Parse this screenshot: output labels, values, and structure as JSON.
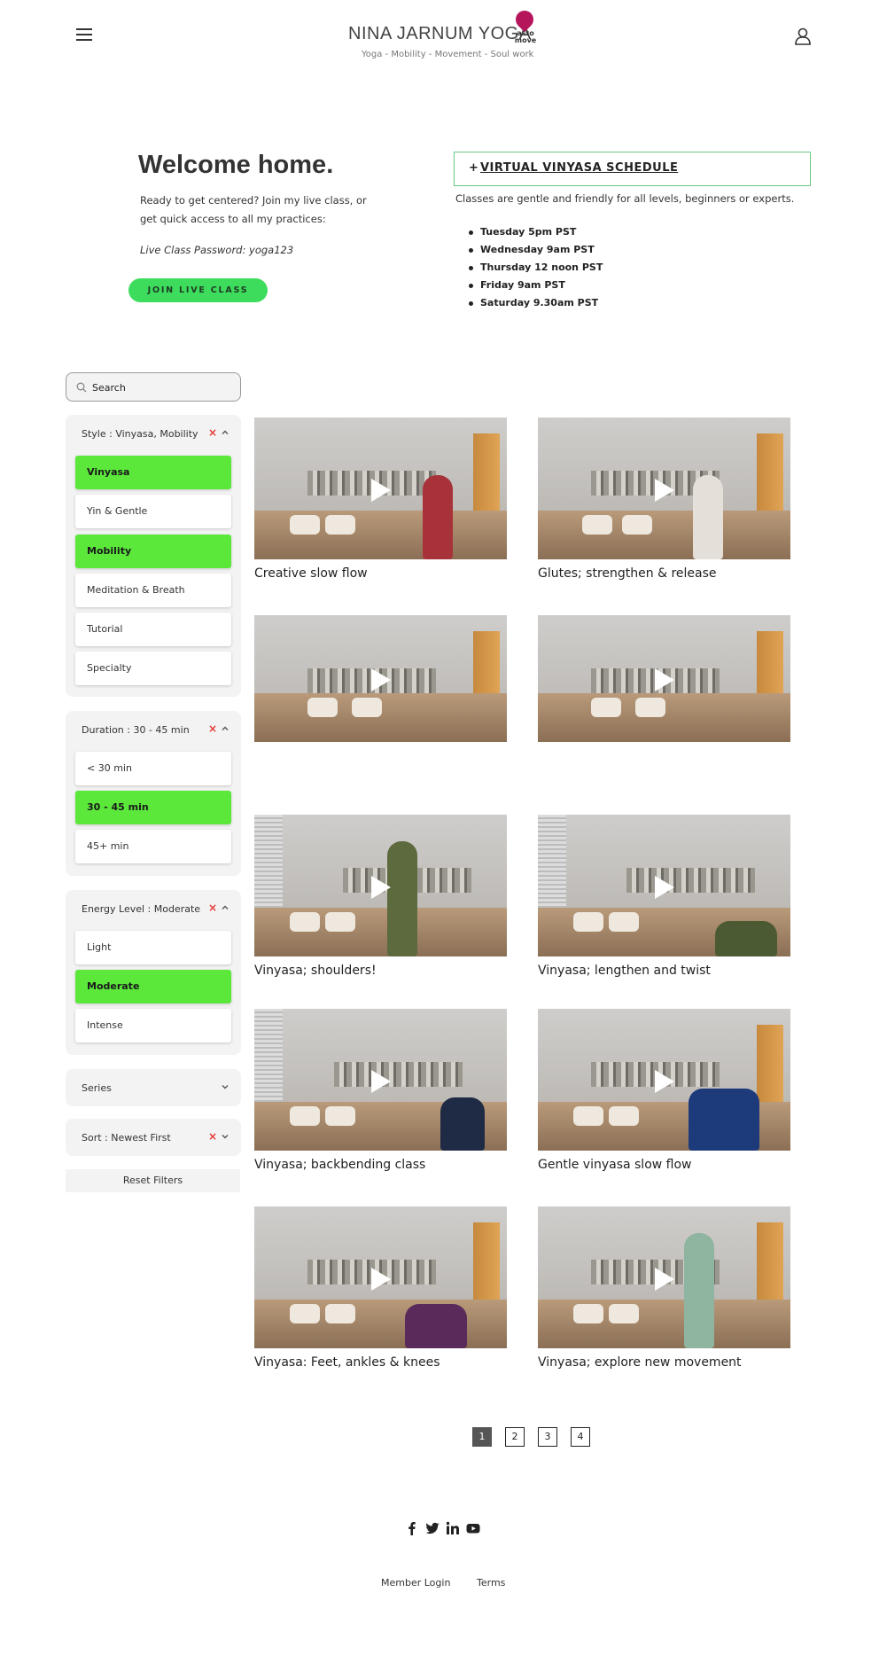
{
  "header": {
    "brand": "NINA JARNUM YOGA",
    "badge_text": "asto move",
    "tagline": "Yoga - Mobility - Movement - Soul work",
    "menu_icon": "hamburger-menu-icon",
    "account_icon": "user-icon"
  },
  "hero": {
    "title": "Welcome home.",
    "intro": "Ready to get centered? Join my live class, or get quick access to all my practices:",
    "password": "Live Class Password: yoga123",
    "join_button": "JOIN LIVE CLASS"
  },
  "schedule": {
    "toggle": "+",
    "title": "VIRTUAL VINYASA SCHEDULE",
    "description": "Classes are gentle and friendly for all levels, beginners or experts.",
    "items": [
      "Tuesday 5pm PST",
      "Wednesday 9am PST",
      "Thursday 12 noon PST",
      "Friday 9am PST",
      "Saturday 9.30am PST"
    ]
  },
  "filters": {
    "search_placeholder": "Search",
    "style": {
      "label": "Style : Vinyasa, Mobility",
      "clear": "×",
      "options": [
        {
          "label": "Vinyasa",
          "active": true
        },
        {
          "label": "Yin & Gentle",
          "active": false
        },
        {
          "label": "Mobility",
          "active": true
        },
        {
          "label": "Meditation & Breath",
          "active": false
        },
        {
          "label": "Tutorial",
          "active": false
        },
        {
          "label": "Specialty",
          "active": false
        }
      ]
    },
    "duration": {
      "label": "Duration : 30 - 45 min",
      "clear": "×",
      "options": [
        {
          "label": "< 30 min",
          "active": false
        },
        {
          "label": "30 - 45 min",
          "active": true
        },
        {
          "label": "45+ min",
          "active": false
        }
      ]
    },
    "energy": {
      "label": "Energy Level : Moderate",
      "clear": "×",
      "options": [
        {
          "label": "Light",
          "active": false
        },
        {
          "label": "Moderate",
          "active": true
        },
        {
          "label": "Intense",
          "active": false
        }
      ]
    },
    "series": {
      "label": "Series"
    },
    "sort": {
      "label": "Sort :  Newest First",
      "clear": "×"
    },
    "reset": "Reset Filters"
  },
  "videos": [
    {
      "title": "Creative slow flow"
    },
    {
      "title": "Glutes; strengthen & release"
    },
    {
      "title": ""
    },
    {
      "title": ""
    },
    {
      "title": "Vinyasa; shoulders!"
    },
    {
      "title": "Vinyasa; lengthen and twist"
    },
    {
      "title": "Vinyasa; backbending class"
    },
    {
      "title": "Gentle vinyasa slow flow"
    },
    {
      "title": "Vinyasa: Feet, ankles & knees"
    },
    {
      "title": "Vinyasa; explore new movement"
    }
  ],
  "pagination": {
    "pages": [
      "1",
      "2",
      "3",
      "4"
    ],
    "current": "1"
  },
  "footer": {
    "social_icons": [
      "facebook-icon",
      "twitter-icon",
      "linkedin-icon",
      "youtube-icon"
    ],
    "links": [
      "Member Login",
      "Terms"
    ]
  },
  "colors": {
    "accent_green": "#3ddc5c",
    "active_filter": "#5be83b",
    "schedule_border": "#6dca7e",
    "brand_badge": "#b5155b",
    "clear_x": "#e53935"
  }
}
